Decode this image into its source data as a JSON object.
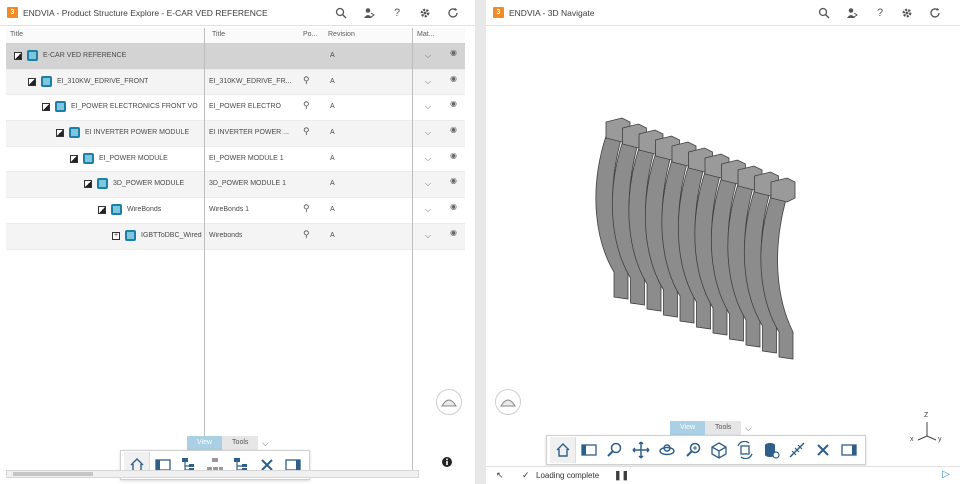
{
  "left_panel": {
    "title": "ENDVIA - Product Structure Explore - E-CAR VED REFERENCE",
    "columns": [
      "Title",
      "Title",
      "Po...",
      "Revision",
      "Mat..."
    ],
    "rows": [
      {
        "name": "E-CAR VED REFERENCE",
        "title": "",
        "revision": "A",
        "level": 0,
        "expander": "open",
        "has_lock": false
      },
      {
        "name": "EI_310KW_EDRIVE_FRONT",
        "title": "EI_310KW_EDRIVE_FR...",
        "revision": "A",
        "level": 1,
        "expander": "open",
        "has_lock": true
      },
      {
        "name": "EI_POWER ELECTRONICS FRONT VO",
        "title": "EI_POWER ELECTRO",
        "revision": "A",
        "level": 2,
        "expander": "open",
        "has_lock": true
      },
      {
        "name": "EI INVERTER POWER MODULE",
        "title": "EI INVERTER POWER ...",
        "revision": "A",
        "level": 3,
        "expander": "open",
        "has_lock": true
      },
      {
        "name": "EI_POWER MODULE",
        "title": "EI_POWER MODULE 1",
        "revision": "A",
        "level": 4,
        "expander": "open",
        "has_lock": false
      },
      {
        "name": "3D_POWER MODULE",
        "title": "3D_POWER MODULE 1",
        "revision": "A",
        "level": 5,
        "expander": "open",
        "has_lock": false
      },
      {
        "name": "WireBonds",
        "title": "WireBonds 1",
        "revision": "A",
        "level": 6,
        "expander": "open",
        "has_lock": true
      },
      {
        "name": "IGBTToDBC_Wired",
        "title": "Wirebonds",
        "revision": "A",
        "level": 7,
        "expander": "plus",
        "has_lock": true
      }
    ],
    "bar_tabs": {
      "view": "View",
      "tools": "Tools"
    }
  },
  "right_panel": {
    "title": "ENDVIA - 3D Navigate",
    "bar_tabs": {
      "view": "View",
      "tools": "Tools"
    },
    "status": "Loading complete",
    "axes": {
      "z": "Z",
      "x": "x",
      "y": "y"
    }
  },
  "icons": {
    "toolbar": [
      "search-icon",
      "user-share-icon",
      "help-icon",
      "settings-icon",
      "refresh-icon"
    ],
    "accent": "#a9d0e4",
    "product_color": "#1b7fa6"
  }
}
